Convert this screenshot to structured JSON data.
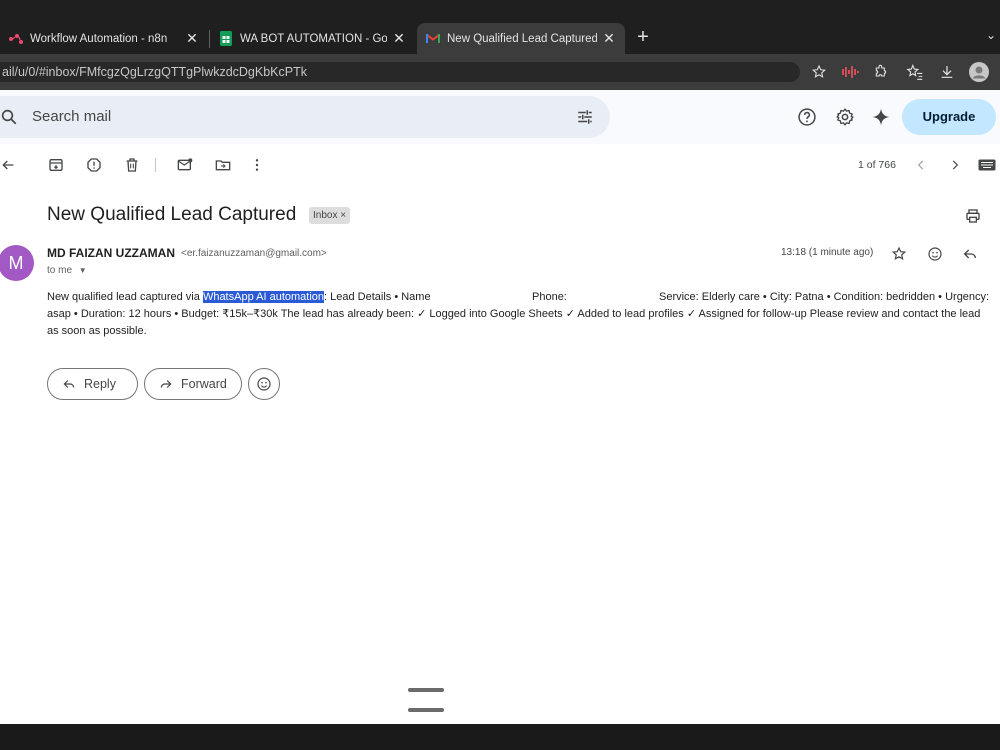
{
  "browser": {
    "tabs": [
      {
        "title": "Workflow Automation - n8n",
        "favicon": "n8n-icon",
        "active": false
      },
      {
        "title": "WA BOT AUTOMATION - Google S",
        "favicon": "sheets-icon",
        "active": false
      },
      {
        "title": "New Qualified Lead Captured - er.",
        "favicon": "gmail-icon",
        "active": true
      }
    ],
    "close_glyph": "✕",
    "new_tab_glyph": "+",
    "url": "ail/u/0/#inbox/FMfcgzQgLrzgQTTgPlwkzdcDgKbKcPTk"
  },
  "gmail": {
    "search_placeholder": "Search mail",
    "upgrade_label": "Upgrade",
    "pagination": "1 of 766",
    "subject": "New Qualified Lead Captured",
    "label_badge": "Inbox ×",
    "avatar_letter": "M",
    "sender_name": "MD FAIZAN UZZAMAN",
    "sender_email": "<er.faizanuzzaman@gmail.com>",
    "to": "to me",
    "timestamp": "13:18 (1 minute ago)",
    "body": {
      "part1": "New qualified lead captured via ",
      "highlighted": "WhatsApp AI automation",
      "part2": ": Lead Details • Name",
      "part3": "Phone:",
      "part4": "Service: Elderly care • City: Patna • Condition: bedridden • Urgency:",
      "line2": "asap • Duration: 12 hours • Budget: ₹15k–₹30k The lead has already been: ✓ Logged into Google Sheets ✓ Added to lead profiles ✓ Assigned for follow-up Please review and contact the lead",
      "line3": "as soon as possible."
    },
    "reply_label": "Reply",
    "forward_label": "Forward"
  }
}
